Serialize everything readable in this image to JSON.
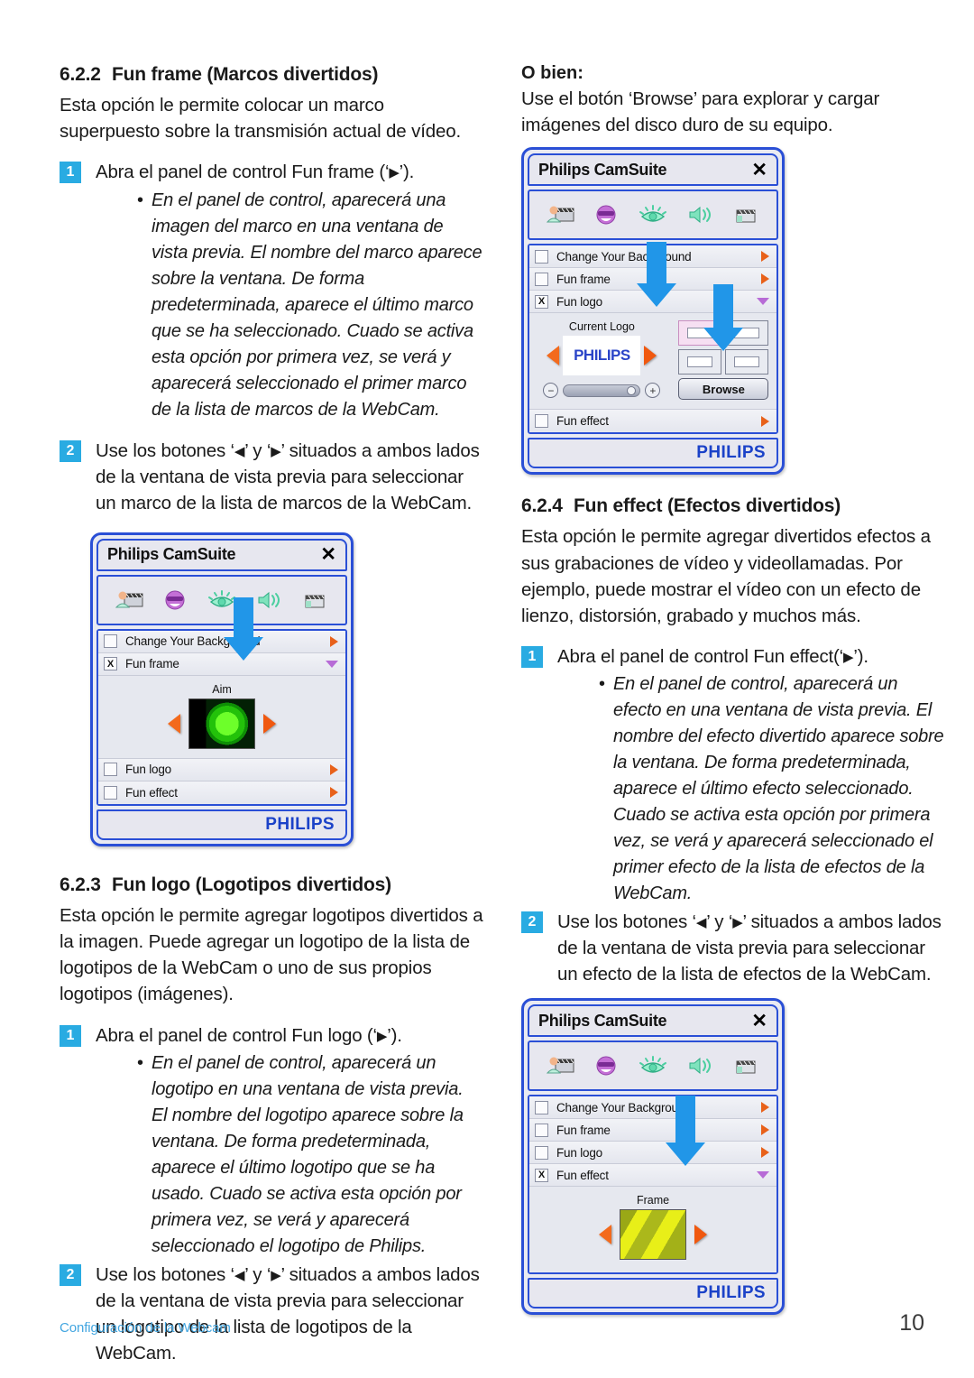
{
  "page": {
    "number": "10",
    "footer_note": "Configuración de la Webcam"
  },
  "left_column": {
    "section_622": {
      "number": "6.2.2",
      "title": "Fun frame (Marcos divertidos)",
      "intro": "Esta opción le permite colocar un marco superpuesto sobre la transmisión actual de vídeo.",
      "step1": {
        "badge": "1",
        "text_before": "Abra el panel de control Fun frame (‘",
        "triangle": "▶",
        "text_after": "’).",
        "bullet": "En el panel de control, aparecerá una imagen del marco en una ventana de vista previa. El nombre del marco aparece sobre la ventana. De forma predeterminada, aparece el último marco que se ha seleccionado. Cuado se activa esta opción por primera vez, se verá y aparecerá seleccionado el primer marco de la lista de marcos de la WebCam."
      },
      "step2": {
        "badge": "2",
        "text_before": "Use los botones ‘",
        "tri_left": "◀",
        "text_mid": "’ y ‘",
        "tri_right": "▶",
        "text_after": "’ situados a ambos lados de la ventana de vista previa para seleccionar un marco de la lista de marcos de la WebCam."
      }
    },
    "section_623": {
      "number": "6.2.3",
      "title": "Fun logo (Logotipos divertidos)",
      "intro": "Esta opción le permite agregar logotipos divertidos a la imagen. Puede agregar un logotipo de la lista de logotipos de la WebCam o uno de sus propios logotipos (imágenes).",
      "step1": {
        "badge": "1",
        "text_before": "Abra el panel de control Fun logo (‘",
        "triangle": "▶",
        "text_after": "’).",
        "bullet": "En el panel de control, aparecerá un logotipo en una ventana de vista previa. El nombre del logotipo aparece sobre la ventana. De forma predeterminada, aparece el último logotipo que se ha usado. Cuado se activa esta opción por primera vez, se verá y aparecerá seleccionado el logotipo de Philips."
      },
      "step2": {
        "badge": "2",
        "text_before": "Use los botones ‘",
        "tri_left": "◀",
        "text_mid": "’ y ‘",
        "tri_right": "▶",
        "text_after": "’ situados a ambos lados de la ventana de vista previa para seleccionar un logotipo de la lista de logotipos de la WebCam."
      }
    }
  },
  "right_column": {
    "obien": {
      "heading": "O bien:",
      "text": "Use el botón ‘Browse’ para explorar y cargar imágenes del disco duro de su equipo."
    },
    "section_624": {
      "number": "6.2.4",
      "title": "Fun effect (Efectos divertidos)",
      "intro": "Esta opción le permite agregar divertidos efectos a sus grabaciones de vídeo y videollamadas. Por ejemplo, puede mostrar el vídeo con un efecto de lienzo, distorsión, grabado y muchos más.",
      "step1": {
        "badge": "1",
        "text_before": "Abra el panel de control Fun effect(‘",
        "triangle": "▶",
        "text_after": "’).",
        "bullet": "En el panel de control, aparecerá un efecto en una ventana de vista previa. El nombre del efecto divertido aparece sobre la ventana. De forma predeterminada, aparece el último efecto seleccionado. Cuado se activa esta opción por primera vez, se verá y aparecerá seleccionado el primer efecto de la lista de efectos de la WebCam."
      },
      "step2": {
        "badge": "2",
        "text_before": "Use los botones ‘",
        "tri_left": "◀",
        "text_mid": "’ y ‘",
        "tri_right": "▶",
        "text_after": "’ situados a ambos lados de la ventana de vista previa para seleccionar un efecto de la lista de efectos de la WebCam."
      }
    }
  },
  "camsuite": {
    "title": "Philips CamSuite",
    "close_glyph": "✕",
    "brand": "PHILIPS",
    "toolbar_icons": [
      "background-clapper-icon",
      "fun-frame-smiley-icon",
      "fun-logo-eye-icon",
      "audio-speaker-icon",
      "fun-effect-clapper-icon"
    ],
    "rows": {
      "change_background": "Change Your Background",
      "fun_frame": "Fun frame",
      "fun_logo": "Fun logo",
      "fun_effect": "Fun effect"
    },
    "checked_glyph": "X",
    "widget_fun_frame": {
      "preview_title": "Aim",
      "checked_row": "Fun frame"
    },
    "widget_fun_logo": {
      "preview_title": "Current Logo",
      "logo_text": "PHILIPS",
      "browse_label": "Browse",
      "minus_glyph": "−",
      "plus_glyph": "+",
      "checked_row": "Fun logo"
    },
    "widget_fun_effect": {
      "preview_title": "Frame",
      "checked_row": "Fun effect"
    }
  },
  "colors": {
    "badge_blue": "#29ABE2",
    "widget_border": "#2A4FD6",
    "arrow_orange": "#E8611A",
    "caret_purple": "#B76BD6",
    "annotation_blue": "#2196E8",
    "philips_blue": "#1B42C8",
    "footer_link": "#43A6E0"
  }
}
